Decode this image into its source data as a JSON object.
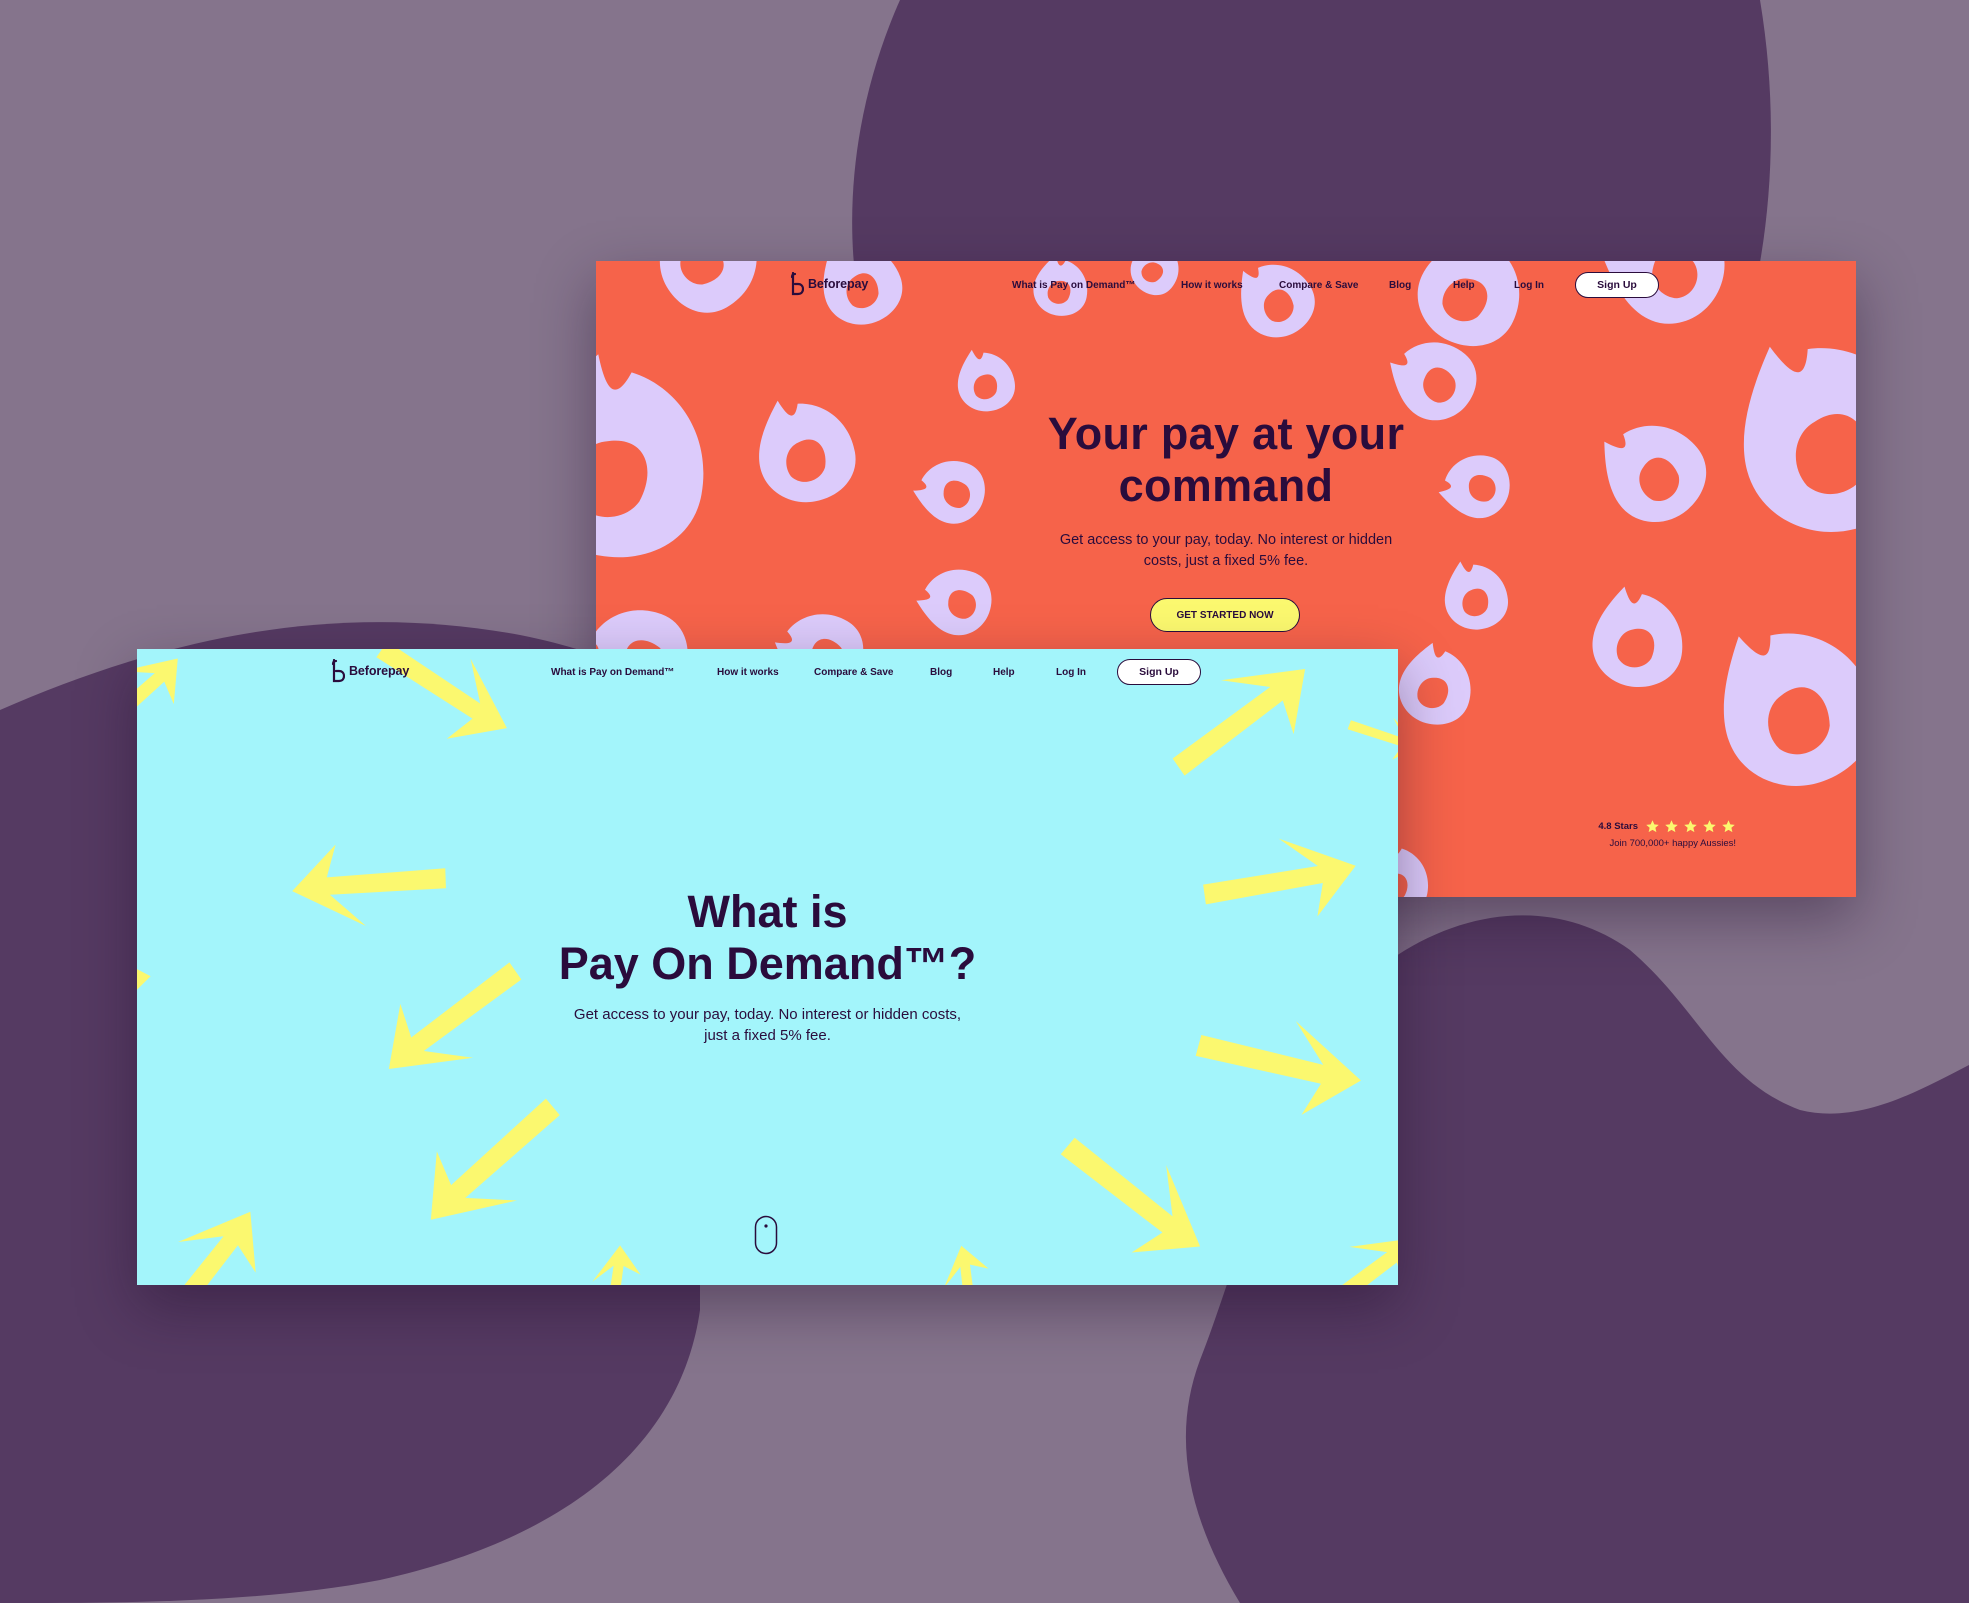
{
  "colors": {
    "backdrop": "#85748c",
    "blob": "#553a62",
    "orange_bg": "#f6634a",
    "lavender_shape": "#dccbfb",
    "blue_bg": "#a3f5fb",
    "yellow_shape": "#fbf86f",
    "text_dark": "#2a0c3c"
  },
  "orange_screen": {
    "brand": {
      "name": "Beforepay",
      "icon": "beforepay-b-logo-icon"
    },
    "nav": {
      "items": [
        {
          "label": "What is Pay on Demand™"
        },
        {
          "label": "How it works"
        },
        {
          "label": "Compare & Save"
        },
        {
          "label": "Blog"
        },
        {
          "label": "Help"
        },
        {
          "label": "Log In"
        }
      ],
      "signup": "Sign Up"
    },
    "hero": {
      "title_line1": "Your pay at your",
      "title_line2": "command",
      "subtitle_line1": "Get access to your pay, today. No interest or hidden",
      "subtitle_line2": "costs, just a fixed 5% fee.",
      "cta": "GET STARTED NOW"
    },
    "rating": {
      "label": "4.8 Stars",
      "stars": 5,
      "note": "Join 700,000+ happy Aussies!"
    },
    "decoration_icon": "lavender-flame-pattern-icon"
  },
  "blue_screen": {
    "brand": {
      "name": "Beforepay",
      "icon": "beforepay-b-logo-icon"
    },
    "nav": {
      "items": [
        {
          "label": "What is Pay on Demand™"
        },
        {
          "label": "How it works"
        },
        {
          "label": "Compare & Save"
        },
        {
          "label": "Blog"
        },
        {
          "label": "Help"
        },
        {
          "label": "Log In"
        }
      ],
      "signup": "Sign Up"
    },
    "hero": {
      "title_line1": "What is",
      "title_line2": "Pay On Demand™?",
      "subtitle_line1": "Get access to your pay, today. No interest or hidden costs,",
      "subtitle_line2": "just a fixed 5% fee."
    },
    "scroll_icon": "scroll-mouse-icon",
    "decoration_icon": "yellow-arrow-pattern-icon"
  }
}
